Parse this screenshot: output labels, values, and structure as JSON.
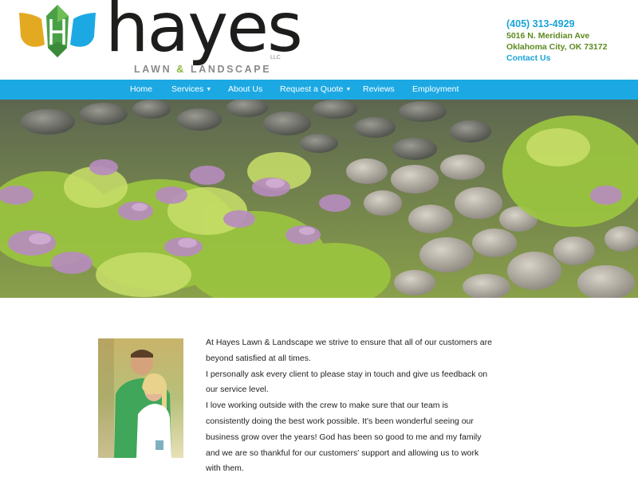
{
  "brand": {
    "name": "hayes",
    "llc": "LLC",
    "sub_left": "LAWN",
    "sub_amp": "&",
    "sub_right": "LANDSCAPE"
  },
  "contact": {
    "phone": "(405) 313-4929",
    "street": "5016 N. Meridian Ave",
    "city": "Oklahoma City, OK 73172",
    "link": "Contact Us"
  },
  "nav": {
    "items": [
      {
        "label": "Home"
      },
      {
        "label": "Services",
        "caret": "▼"
      },
      {
        "label": "About Us"
      },
      {
        "label": "Request a Quote",
        "caret": "▼"
      },
      {
        "label": "Reviews"
      },
      {
        "label": "Employment"
      }
    ]
  },
  "hero": {
    "icon": "landscape-photo"
  },
  "about": {
    "photo_icon": "couple-photo",
    "paragraphs": [
      "At Hayes Lawn & Landscape we strive to ensure that all of our customers are beyond satisfied at all times.",
      "I personally ask every client to please stay in touch and give us feedback on our service level.",
      "I love working outside with the crew to make sure that our team is consistently doing the best work possible. It's been wonderful seeing our business grow over the years! God has been so good to me and my family and we are so thankful for our customers' support and allowing us to work with them."
    ]
  },
  "colors": {
    "nav_bg": "#1ca9e3",
    "accent_blue": "#1aa3d8",
    "accent_green": "#5d8a1f",
    "logo_yellow": "#e3a921",
    "logo_green": "#4aa046",
    "logo_blue": "#1ca9e3"
  }
}
